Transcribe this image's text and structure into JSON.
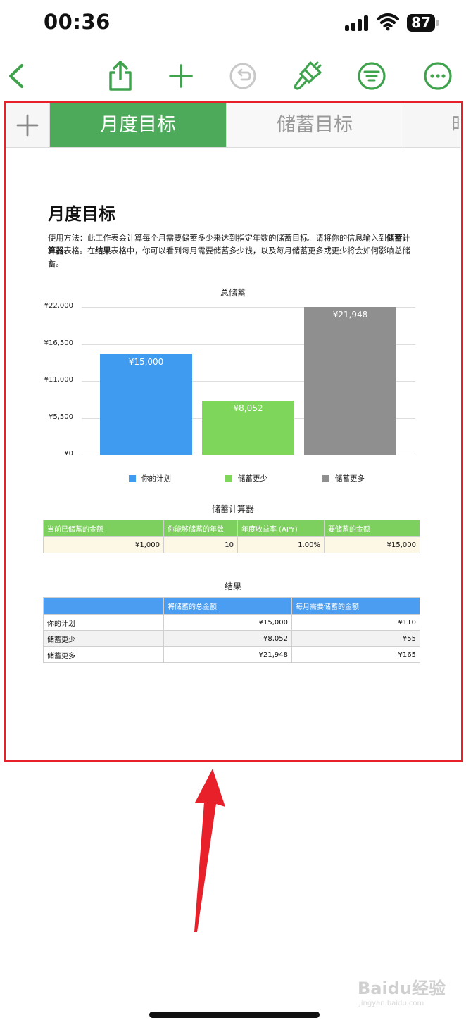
{
  "status": {
    "time": "00:36",
    "battery": "87"
  },
  "toolbar": {
    "back": "chevron-left-icon",
    "share": "share-icon",
    "add": "plus-icon",
    "undo": "undo-icon",
    "format": "paintbrush-icon",
    "organize": "filter-icon",
    "more": "more-icon",
    "accent": "#3fa34d"
  },
  "tabs": [
    {
      "label": "月度目标",
      "active": true
    },
    {
      "label": "储蓄目标",
      "active": false
    },
    {
      "label": "时",
      "active": false
    }
  ],
  "sheet": {
    "title": "月度目标",
    "desc_a": "使用方法：此工作表会计算每个月需要储蓄多少来达到指定年数的储蓄目标。请将你的信息输入到",
    "desc_b": "储蓄计算器",
    "desc_c": "表格。在",
    "desc_d": "结果",
    "desc_e": "表格中，你可以看到每月需要储蓄多少钱，以及每月储蓄更多或更少将会如何影响总储蓄。"
  },
  "chart_data": {
    "type": "bar",
    "title": "总储蓄",
    "categories": [
      "你的计划",
      "储蓄更少",
      "储蓄更多"
    ],
    "values": [
      15000,
      8052,
      21948
    ],
    "value_labels": [
      "¥15,000",
      "¥8,052",
      "¥21,948"
    ],
    "colors": [
      "#3f9bf0",
      "#7ed65a",
      "#8f8f8f"
    ],
    "yticks": [
      "¥0",
      "¥5,500",
      "¥11,000",
      "¥16,500",
      "¥22,000"
    ],
    "ylim": [
      0,
      22000
    ],
    "legend_position": "bottom",
    "grid": true
  },
  "calculator": {
    "title": "储蓄计算器",
    "headers": [
      "当前已储蓄的金额",
      "你能够储蓄的年数",
      "年度收益率 (APY)",
      "要储蓄的金额"
    ],
    "values": [
      "¥1,000",
      "10",
      "1.00%",
      "¥15,000"
    ]
  },
  "results": {
    "title": "结果",
    "headers": [
      "",
      "将储蓄的总金额",
      "每月需要储蓄的金额"
    ],
    "rows": [
      [
        "你的计划",
        "¥15,000",
        "¥110"
      ],
      [
        "储蓄更少",
        "¥8,052",
        "¥55"
      ],
      [
        "储蓄更多",
        "¥21,948",
        "¥165"
      ]
    ]
  },
  "watermark": {
    "brand": "Baidu经验",
    "sub": "jingyan.baidu.com"
  }
}
